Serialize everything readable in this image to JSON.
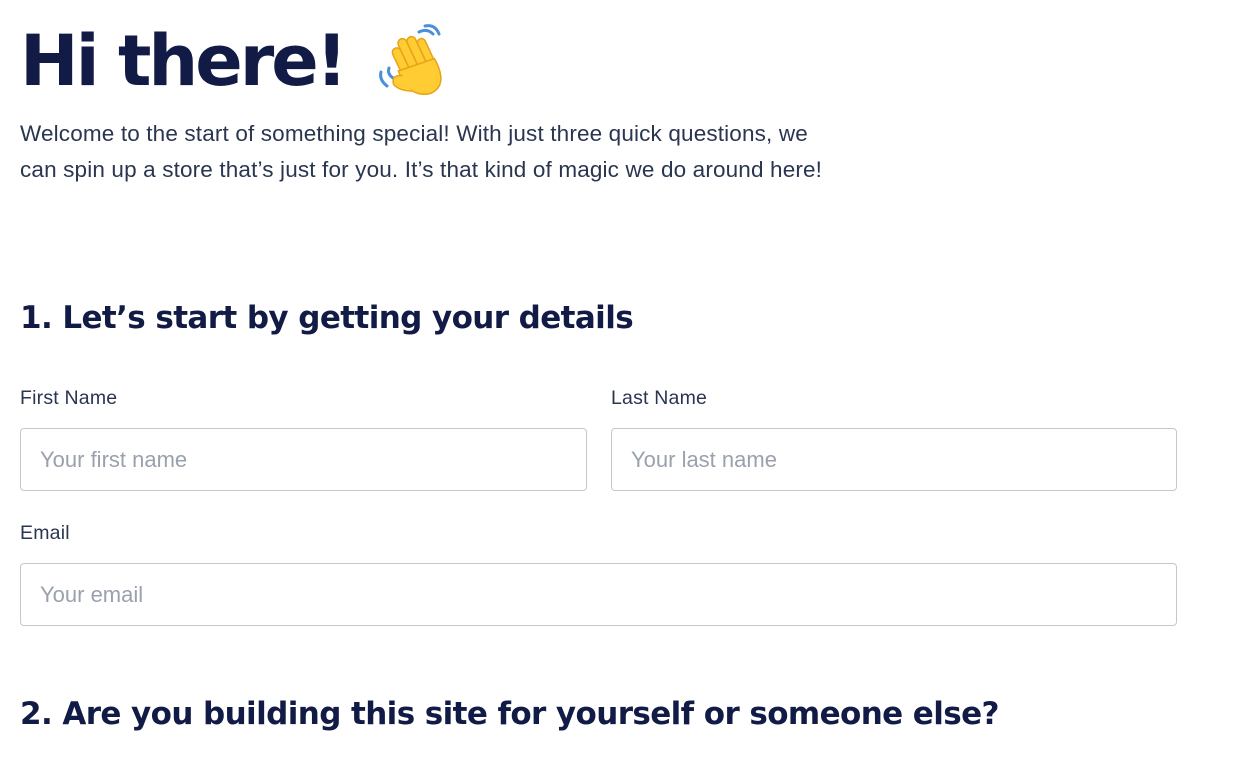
{
  "header": {
    "title": "Hi there!",
    "emoji_icon": "waving-hand-icon"
  },
  "intro": {
    "text": "Welcome to the start of something special! With just three quick questions, we can spin up a store that’s just for you. It’s that kind of magic we do around here!"
  },
  "section_1": {
    "title": "1. Let’s start by getting your details",
    "first_name": {
      "label": "First Name",
      "placeholder": "Your first name",
      "value": ""
    },
    "last_name": {
      "label": "Last Name",
      "placeholder": "Your last name",
      "value": ""
    },
    "email": {
      "label": "Email",
      "placeholder": "Your email",
      "value": ""
    }
  },
  "section_2": {
    "title": "2. Are you building this site for yourself or someone else?"
  },
  "colors": {
    "heading": "#121b45",
    "body_text": "#2a3550",
    "input_border": "#c3c7cf",
    "placeholder": "#9aa1ad",
    "emoji_yellow": "#ffcc33",
    "emoji_motion": "#4a90d9"
  }
}
